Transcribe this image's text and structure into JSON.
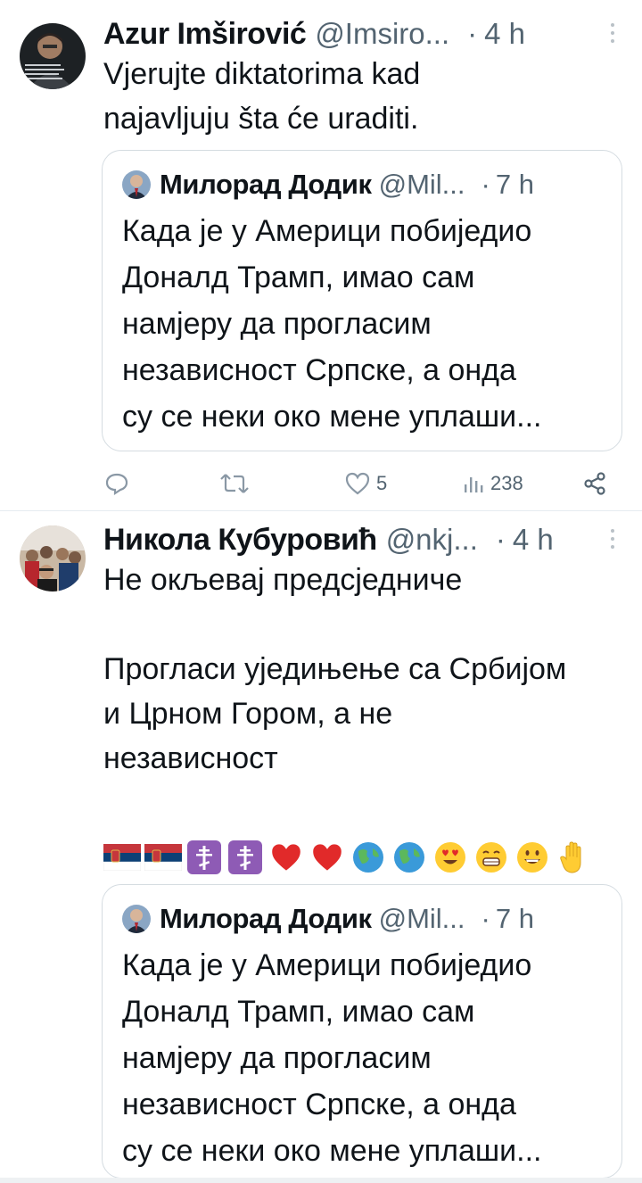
{
  "tweets": [
    {
      "author_name": "Azur Imširović",
      "handle": "@Imsiro...",
      "separator": "·",
      "time": "4 h",
      "text": "Vjerujte diktatorima kad\nnajavljuju šta će uraditi.",
      "avatar_icon": "dark-portrait-avatar",
      "quote": {
        "author_name": "Милорад Додик",
        "handle": "@Mil...",
        "separator": "·",
        "time": "7 h",
        "text": "Када је у Америци побиједио\nДоналд Трамп, имао сам\nнамјеру да прогласим\nнезависност Српске, а онда\nсу се неки око мене уплаши..."
      },
      "actions": {
        "reply_count": "",
        "retweet_count": "",
        "like_count": "5",
        "views_count": "238"
      }
    },
    {
      "author_name": "Никола Кубуровић",
      "handle": "@nkj...",
      "separator": "·",
      "time": "4 h",
      "text": "Не окљевај предсједниче\n\nПрогласи уједињење са Србијом\nи Црном Гором, а не\nнезависност",
      "emoji_icons": [
        "serbia-flag-icon",
        "serbia-flag-icon",
        "orthodox-cross-icon",
        "orthodox-cross-icon",
        "red-heart-icon",
        "red-heart-icon",
        "globe-icon",
        "globe-icon",
        "heart-eyes-face-icon",
        "grinning-teeth-face-icon",
        "grinning-face-icon",
        "raised-hand-icon"
      ],
      "quote": {
        "author_name": "Милорад Додик",
        "handle": "@Mil...",
        "separator": "·",
        "time": "7 h",
        "text": "Када је у Америци побиједио\nДоналд Трамп, имао сам\nнамјеру да прогласим\nнезависност Српске, а онда\nсу се неки око мене уплаши..."
      }
    }
  ],
  "colors": {
    "text": "#0f1419",
    "secondary": "#536471",
    "border": "#d5dce1"
  }
}
